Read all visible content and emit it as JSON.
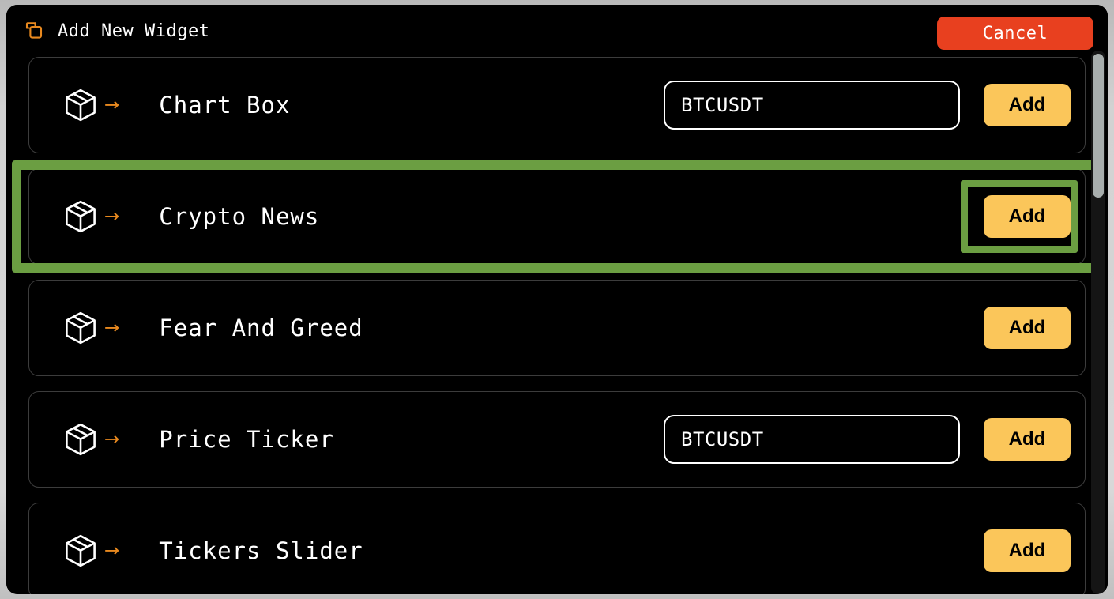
{
  "header": {
    "icon": "copy-duplicate-icon",
    "title": "Add New Widget",
    "cancel_label": "Cancel",
    "cancel_color": "#e8401f"
  },
  "theme": {
    "background": "#000000",
    "accent_orange": "#e8891f",
    "add_button": "#fbc65a",
    "highlight_green": "#6b9e42",
    "text": "#ffffff"
  },
  "widgets": [
    {
      "icon": "package-box-icon",
      "arrow": "→",
      "label": "Chart Box",
      "has_input": true,
      "input_value": "BTCUSDT",
      "input_placeholder": "BTCUSDT",
      "add_label": "Add",
      "highlighted": false,
      "button_highlighted": false
    },
    {
      "icon": "package-box-icon",
      "arrow": "→",
      "label": "Crypto News",
      "has_input": false,
      "input_value": "",
      "input_placeholder": "",
      "add_label": "Add",
      "highlighted": true,
      "button_highlighted": true
    },
    {
      "icon": "package-box-icon",
      "arrow": "→",
      "label": "Fear And Greed",
      "has_input": false,
      "input_value": "",
      "input_placeholder": "",
      "add_label": "Add",
      "highlighted": false,
      "button_highlighted": false
    },
    {
      "icon": "package-box-icon",
      "arrow": "→",
      "label": "Price Ticker",
      "has_input": true,
      "input_value": "BTCUSDT",
      "input_placeholder": "BTCUSDT",
      "add_label": "Add",
      "highlighted": false,
      "button_highlighted": false
    },
    {
      "icon": "package-box-icon",
      "arrow": "→",
      "label": "Tickers Slider",
      "has_input": false,
      "input_value": "",
      "input_placeholder": "",
      "add_label": "Add",
      "highlighted": false,
      "button_highlighted": false
    }
  ],
  "scrollbar": {
    "name": "vertical-scrollbar",
    "thumb_position_percent": 0
  }
}
